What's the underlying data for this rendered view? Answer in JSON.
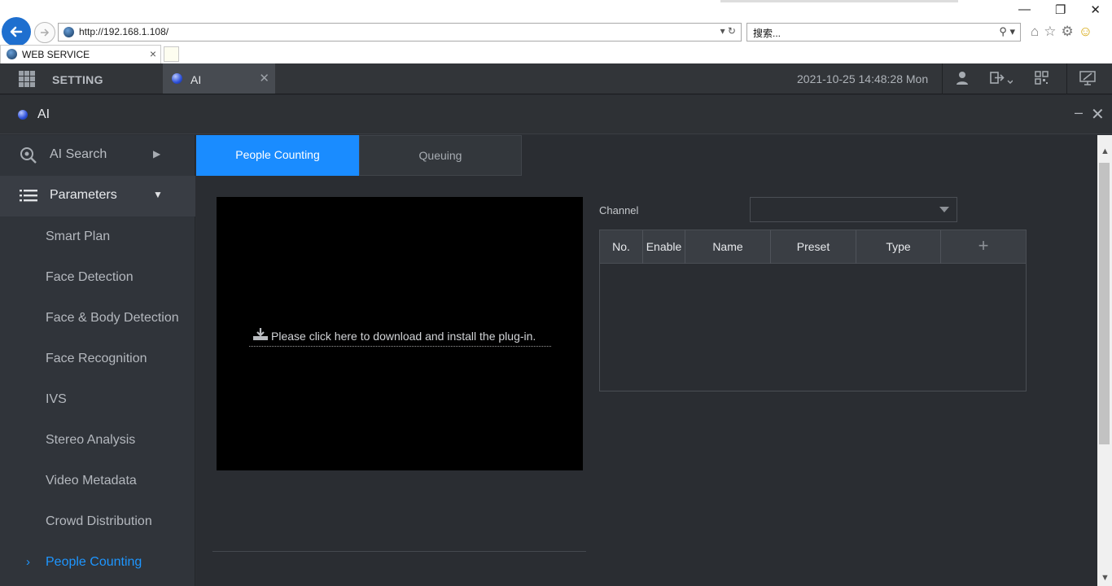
{
  "browser": {
    "url": "http://192.168.1.108/",
    "search_placeholder": "搜索...",
    "tab_title": "WEB SERVICE"
  },
  "appbar": {
    "menu_label": "SETTING",
    "tab_label": "AI",
    "datetime": "2021-10-25 14:48:28 Mon"
  },
  "panel": {
    "title": "AI"
  },
  "sidebar": {
    "sections": [
      {
        "label": "AI Search",
        "expanded": false
      },
      {
        "label": "Parameters",
        "expanded": true
      }
    ],
    "items": [
      {
        "label": "Smart Plan"
      },
      {
        "label": "Face Detection"
      },
      {
        "label": "Face & Body Detection"
      },
      {
        "label": "Face Recognition"
      },
      {
        "label": "IVS"
      },
      {
        "label": "Stereo Analysis"
      },
      {
        "label": "Video Metadata"
      },
      {
        "label": "Crowd Distribution"
      },
      {
        "label": "People Counting",
        "current": true
      }
    ]
  },
  "content": {
    "tabs": [
      {
        "label": "People Counting",
        "active": true
      },
      {
        "label": "Queuing",
        "active": false
      }
    ],
    "plugin_message": "Please click here to download and install the plug-in.",
    "channel_label": "Channel",
    "channel_value": "",
    "table": {
      "columns": [
        "No.",
        "Enable",
        "Name",
        "Preset",
        "Type",
        "+"
      ],
      "rows": []
    }
  },
  "colors": {
    "accent": "#1a8cff",
    "background": "#2a2d32",
    "sidebar": "#30343a"
  }
}
